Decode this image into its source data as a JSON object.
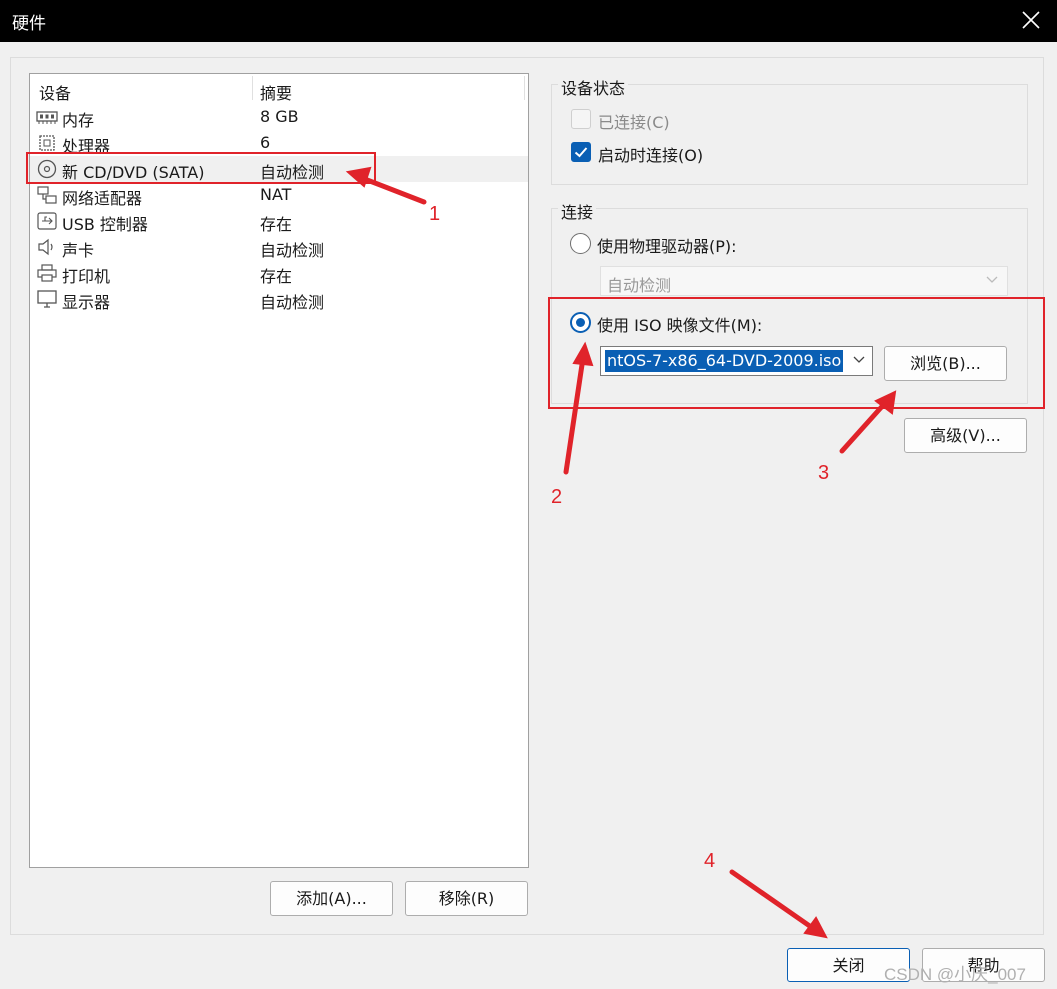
{
  "window": {
    "title": "硬件",
    "close_icon": "close-icon"
  },
  "device_list": {
    "columns": [
      "设备",
      "摘要"
    ],
    "rows": [
      {
        "name": "内存",
        "summary": "8 GB",
        "icon": "memory-icon"
      },
      {
        "name": "处理器",
        "summary": "6",
        "icon": "cpu-icon"
      },
      {
        "name": "新 CD/DVD (SATA)",
        "summary": "自动检测",
        "icon": "cd-dvd-icon",
        "selected": true
      },
      {
        "name": "网络适配器",
        "summary": "NAT",
        "icon": "network-icon"
      },
      {
        "name": "USB 控制器",
        "summary": "存在",
        "icon": "usb-icon"
      },
      {
        "name": "声卡",
        "summary": "自动检测",
        "icon": "speaker-icon"
      },
      {
        "name": "打印机",
        "summary": "存在",
        "icon": "printer-icon"
      },
      {
        "name": "显示器",
        "summary": "自动检测",
        "icon": "monitor-icon"
      }
    ],
    "add_label": "添加(A)...",
    "remove_label": "移除(R)"
  },
  "device_status": {
    "group_label": "设备状态",
    "connected_label": "已连接(C)",
    "connected_checked": false,
    "connect_at_power_on_label": "启动时连接(O)",
    "connect_at_power_on_checked": true
  },
  "connection": {
    "group_label": "连接",
    "physical_label": "使用物理驱动器(P):",
    "physical_value": "自动检测",
    "iso_label": "使用 ISO 映像文件(M):",
    "iso_value": "ntOS-7-x86_64-DVD-2009.iso",
    "browse_label": "浏览(B)...",
    "selected": "iso"
  },
  "advanced_label": "高级(V)...",
  "footer": {
    "close_label": "关闭",
    "help_label": "帮助"
  },
  "annotations": [
    "1",
    "2",
    "3",
    "4"
  ],
  "watermark": "CSDN @小庆_007",
  "colors": {
    "annotation_red": "#e0232a",
    "accent_blue": "#0a5fb4"
  }
}
